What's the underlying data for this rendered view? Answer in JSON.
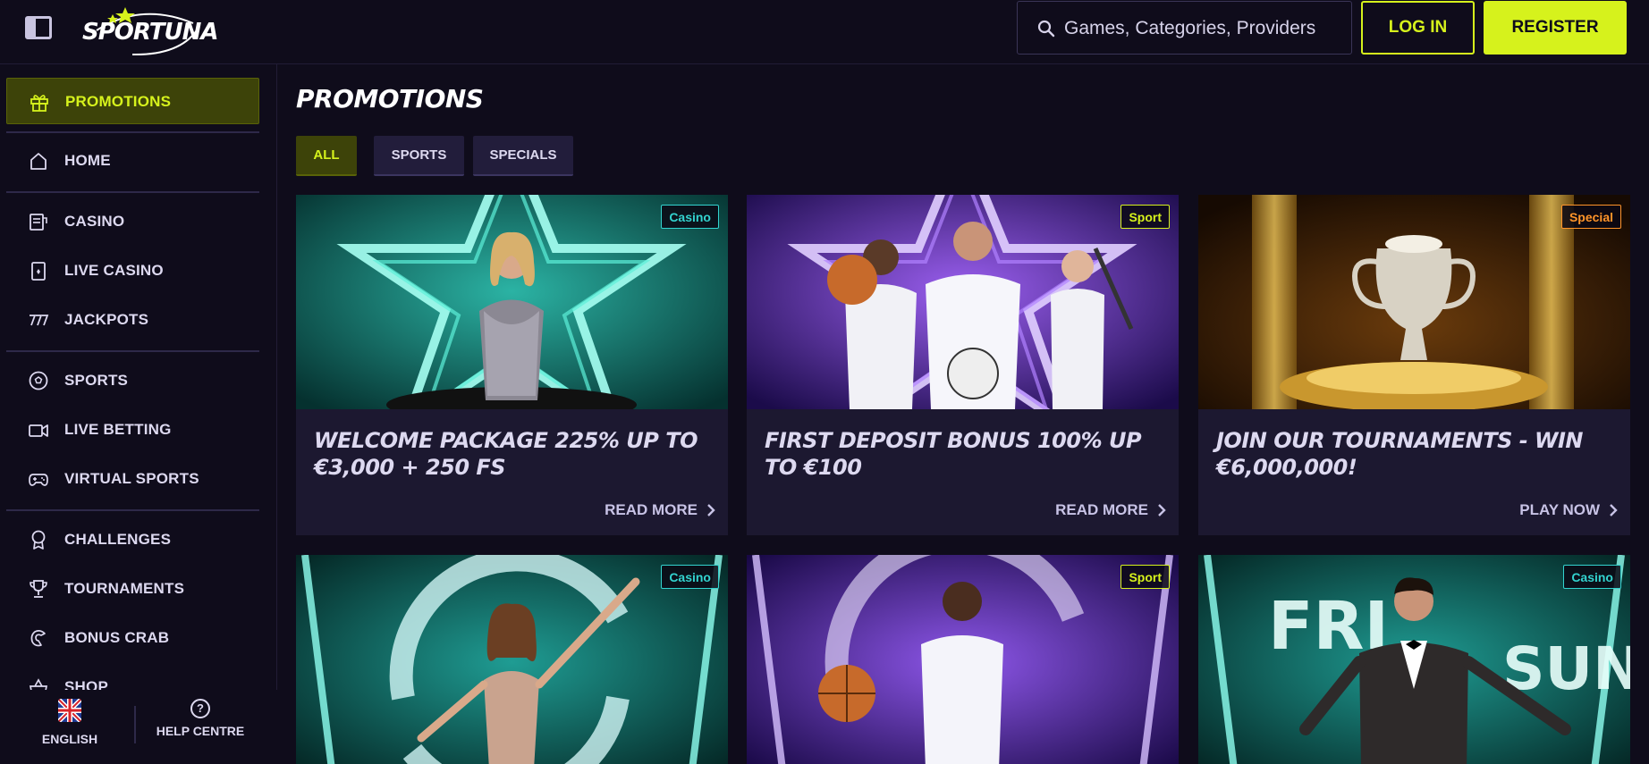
{
  "header": {
    "logo_text": "SPORTUNA",
    "search_placeholder": "Games, Categories, Providers",
    "login_label": "LOG IN",
    "register_label": "REGISTER"
  },
  "sidebar": {
    "items": [
      {
        "label": "PROMOTIONS",
        "icon": "gift-icon",
        "active": true
      },
      {
        "label": "HOME",
        "icon": "home-icon"
      },
      {
        "label": "CASINO",
        "icon": "casino-icon"
      },
      {
        "label": "LIVE CASINO",
        "icon": "live-casino-icon"
      },
      {
        "label": "JACKPOTS",
        "icon": "jackpot-777-icon"
      },
      {
        "label": "SPORTS",
        "icon": "soccer-ball-icon"
      },
      {
        "label": "LIVE BETTING",
        "icon": "video-camera-icon"
      },
      {
        "label": "VIRTUAL SPORTS",
        "icon": "gamepad-icon"
      },
      {
        "label": "CHALLENGES",
        "icon": "medal-icon"
      },
      {
        "label": "TOURNAMENTS",
        "icon": "trophy-icon"
      },
      {
        "label": "BONUS CRAB",
        "icon": "crab-claw-icon"
      },
      {
        "label": "SHOP",
        "icon": "shop-basket-icon"
      }
    ],
    "footer": {
      "language_label": "ENGLISH",
      "help_label": "HELP CENTRE"
    }
  },
  "main": {
    "title": "PROMOTIONS",
    "filters": [
      {
        "label": "ALL",
        "active": true
      },
      {
        "label": "SPORTS"
      },
      {
        "label": "SPECIALS"
      }
    ],
    "cards": [
      {
        "badge": "Casino",
        "title": "WELCOME PACKAGE 225% UP TO €3,000 + 250 FS",
        "cta": "READ MORE"
      },
      {
        "badge": "Sport",
        "title": "FIRST DEPOSIT BONUS 100% UP TO €100",
        "cta": "READ MORE"
      },
      {
        "badge": "Special",
        "title": "JOIN OUR TOURNAMENTS - WIN €6,000,000!",
        "cta": "PLAY NOW"
      },
      {
        "badge": "Casino"
      },
      {
        "badge": "Sport"
      },
      {
        "badge": "Casino",
        "image_text_left": "FRI",
        "image_text_right": "SUN"
      }
    ]
  },
  "colors": {
    "background": "#0f0c1b",
    "accent": "#d6f21c",
    "card": "#1c1830",
    "casino_badge": "#33d3cf",
    "special_badge": "#ff9429"
  }
}
